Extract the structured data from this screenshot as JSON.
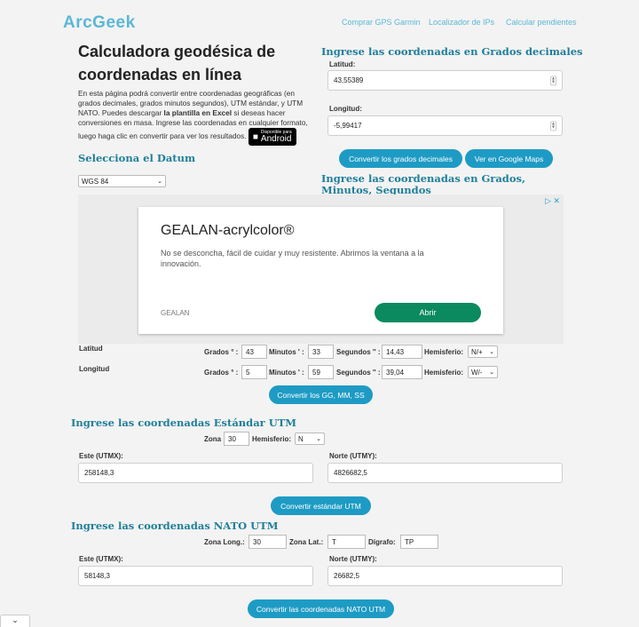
{
  "header": {
    "logo": "ArcGeek",
    "nav": [
      "Comprar GPS Garmin",
      "Localizador de IPs",
      "Calcular pendientes"
    ]
  },
  "intro": {
    "title": "Calculadora geodésica de coordenadas en línea",
    "text_before": "En esta página podrá convertir entre coordenadas geográficas (en grados decimales, grados minutos segundos), UTM estándar, y UTM NATO. Puedes descargar ",
    "text_link": "la plantilla en Excel",
    "text_after": " si deseas hacer conversiones en masa. Ingrese las coordenadas en cualquier formato, luego haga clic en convertir para ver los resultados.",
    "badge_small": "Disponible para",
    "badge_big": "Android"
  },
  "datum": {
    "heading": "Selecciona el Datum",
    "selected": "WGS 84"
  },
  "decimal": {
    "heading": "Ingrese las coordenadas en Grados decimales",
    "lat_label": "Latitud:",
    "lat_value": "43,55389",
    "lon_label": "Longitud:",
    "lon_value": "-5,99417",
    "convert_btn": "Convertir los grados decimales",
    "maps_btn": "Ver en Google Maps"
  },
  "dms": {
    "heading": "Ingrese las coordenadas en Grados, Minutos, Segundos",
    "lat_row_label": "Latitud",
    "lon_row_label": "Longitud",
    "deg_label": "Grados ° :",
    "min_label": "Minutos ' :",
    "sec_label": "Segundos '' :",
    "hem_label": "Hemisferio:",
    "lat_deg": "43",
    "lat_min": "33",
    "lat_sec": "14,43",
    "lat_hem": "N/+",
    "lon_deg": "5",
    "lon_min": "59",
    "lon_sec": "39,04",
    "lon_hem": "W/-",
    "convert_btn": "Convertir los GG, MM, SS"
  },
  "ad": {
    "title": "GEALAN-acrylcolor®",
    "text": "No se desconcha, fácil de cuidar y muy resistente. Abrimos la ventana a la innovación.",
    "brand": "GEALAN",
    "cta": "Abrir"
  },
  "utm": {
    "heading": "Ingrese las coordenadas Estándar UTM",
    "zone_label": "Zona",
    "zone_value": "30",
    "hem_label": "Hemisferio:",
    "hem_value": "N",
    "east_label": "Este (UTMX):",
    "east_value": "258148,3",
    "north_label": "Norte (UTMY):",
    "north_value": "4826682,5",
    "convert_btn": "Convertir estándar UTM"
  },
  "nato": {
    "heading": "Ingrese las coordenadas NATO UTM",
    "zone_long_label": "Zona Long.:",
    "zone_long_value": "30",
    "zone_lat_label": "Zona Lat.:",
    "zone_lat_value": "T",
    "digraph_label": "Dígrafo:",
    "digraph_value": "TP",
    "east_label": "Este (UTMX):",
    "east_value": "58148,3",
    "north_label": "Norte (UTMY):",
    "north_value": "26682,5",
    "convert_btn": "Convertir las coordenadas NATO UTM"
  }
}
